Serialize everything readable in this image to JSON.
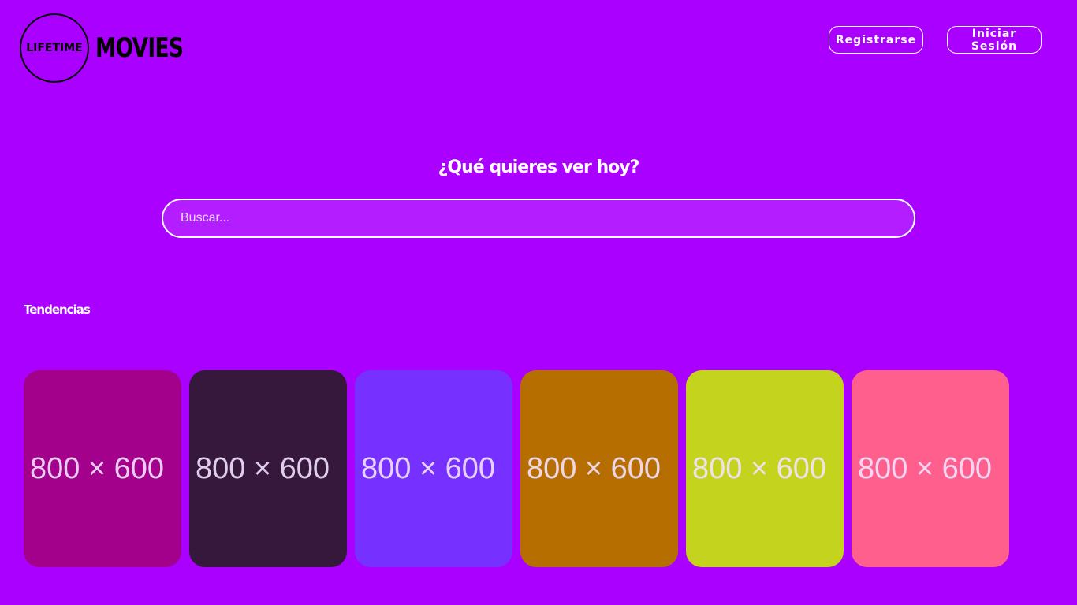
{
  "logo": {
    "circle_text": "LIFETIME",
    "word": "MOVIES"
  },
  "header": {
    "register_label": "Registrarse",
    "login_label": "Iniciar Sesión"
  },
  "hero": {
    "title": "¿Qué quieres ver hoy?",
    "search_placeholder": "Buscar..."
  },
  "trending": {
    "title": "Tendencias",
    "cards": [
      {
        "label": "800 × 600",
        "color": "#a3008c"
      },
      {
        "label": "800 × 600",
        "color": "#36183c"
      },
      {
        "label": "800 × 600",
        "color": "#7630ff"
      },
      {
        "label": "800 × 600",
        "color": "#b66e00"
      },
      {
        "label": "800 × 600",
        "color": "#c4d41e"
      },
      {
        "label": "800 × 600",
        "color": "#ff5f8c"
      }
    ]
  },
  "colors": {
    "background": "#aa00ff",
    "search_fill": "#b41dff"
  }
}
